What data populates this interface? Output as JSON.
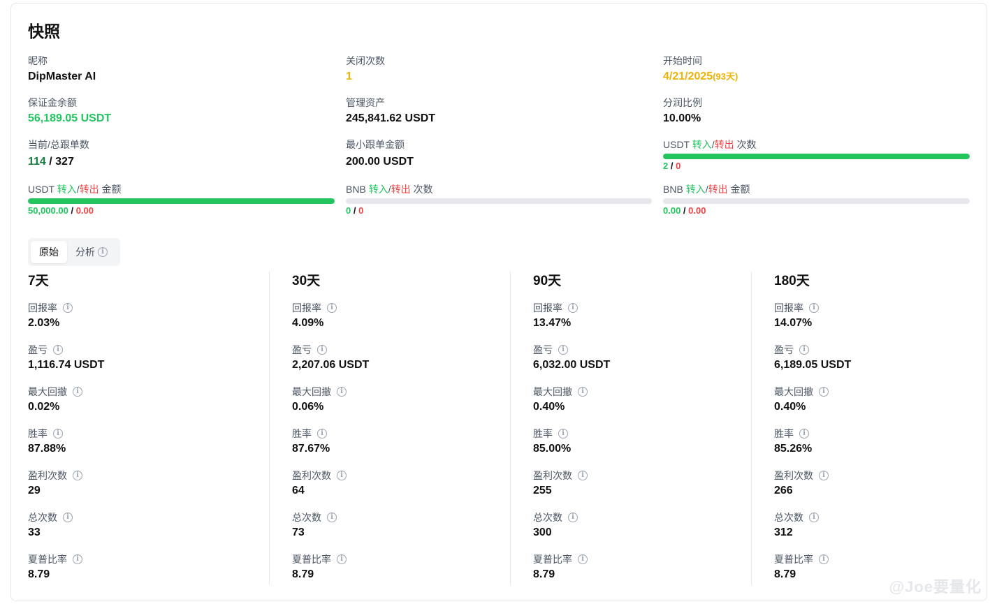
{
  "title": "快照",
  "info": {
    "nickname_label": "昵称",
    "nickname": "DipMaster AI",
    "close_count_label": "关闭次数",
    "close_count": "1",
    "start_time_label": "开始时间",
    "start_time": "4/21/2025",
    "start_days": "(93天)",
    "margin_balance_label": "保证金余额",
    "margin_balance": "56,189.05 USDT",
    "aum_label": "管理资产",
    "aum": "245,841.62 USDT",
    "profit_share_label": "分润比例",
    "profit_share": "10.00%",
    "copy_orders_label": "当前/总跟单数",
    "copy_orders_current": "114",
    "copy_orders_total": "/ 327",
    "min_copy_label": "最小跟单金额",
    "min_copy": "200.00 USDT"
  },
  "transfers": {
    "word_in": "转入",
    "word_out": "转出",
    "slash": "/",
    "usdt_count": {
      "prefix": "USDT",
      "suffix": "次数",
      "in": "2",
      "out": "0",
      "fill": 1.0
    },
    "usdt_amount": {
      "prefix": "USDT",
      "suffix": "金额",
      "in": "50,000.00",
      "out": "0.00",
      "fill": 1.0
    },
    "bnb_count": {
      "prefix": "BNB",
      "suffix": "次数",
      "in": "0",
      "out": "0",
      "fill": 0.0
    },
    "bnb_amount": {
      "prefix": "BNB",
      "suffix": "金额",
      "in": "0.00",
      "out": "0.00",
      "fill": 0.0
    },
    "sep": " / "
  },
  "tabs": {
    "raw": "原始",
    "analysis": "分析"
  },
  "metric_labels": {
    "return_rate": "回报率",
    "pnl": "盈亏",
    "max_drawdown": "最大回撤",
    "win_rate": "胜率",
    "win_count": "盈利次数",
    "total_count": "总次数",
    "sharpe": "夏普比率"
  },
  "periods": [
    {
      "name": "7天",
      "return_rate": "2.03%",
      "pnl": "1,116.74 USDT",
      "max_drawdown": "0.02%",
      "win_rate": "87.88%",
      "win_count": "29",
      "total_count": "33",
      "sharpe": "8.79"
    },
    {
      "name": "30天",
      "return_rate": "4.09%",
      "pnl": "2,207.06 USDT",
      "max_drawdown": "0.06%",
      "win_rate": "87.67%",
      "win_count": "64",
      "total_count": "73",
      "sharpe": "8.79"
    },
    {
      "name": "90天",
      "return_rate": "13.47%",
      "pnl": "6,032.00 USDT",
      "max_drawdown": "0.40%",
      "win_rate": "85.00%",
      "win_count": "255",
      "total_count": "300",
      "sharpe": "8.79"
    },
    {
      "name": "180天",
      "return_rate": "14.07%",
      "pnl": "6,189.05 USDT",
      "max_drawdown": "0.40%",
      "win_rate": "85.26%",
      "win_count": "266",
      "total_count": "312",
      "sharpe": "8.79"
    }
  ],
  "info_icon_glyph": "i",
  "watermark": "@Joe要量化",
  "colors": {
    "green": "#22c55e",
    "red": "#ef4444",
    "amber": "#eab308",
    "dark_green": "#15803d"
  }
}
